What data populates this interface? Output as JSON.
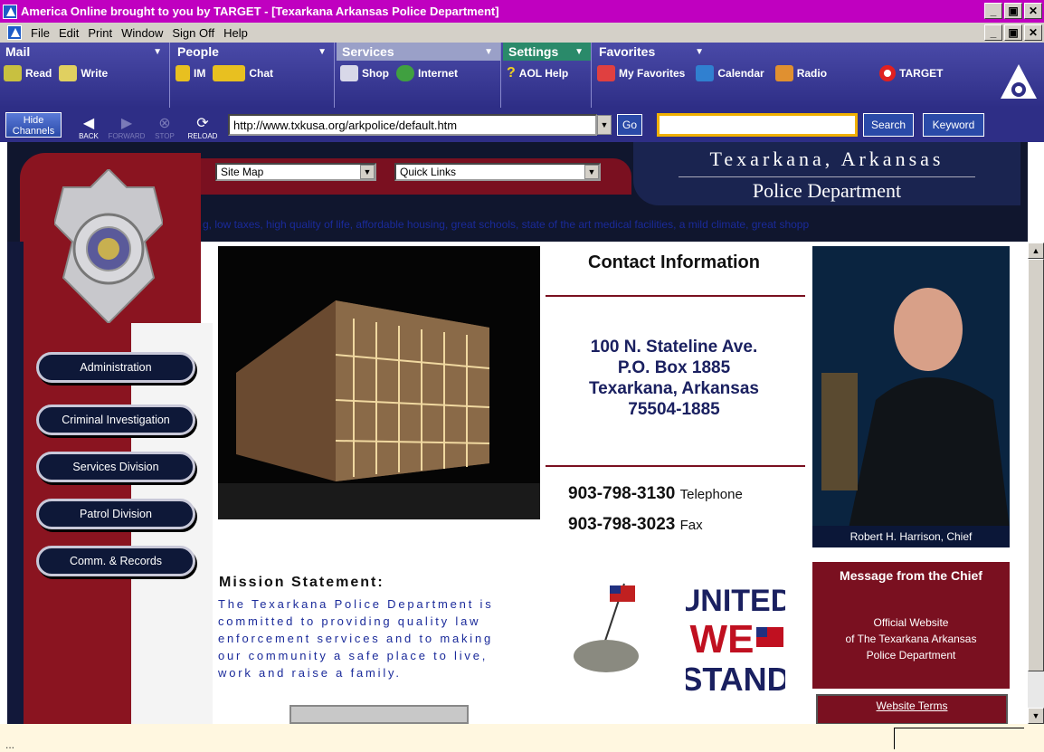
{
  "window": {
    "title": "America  Online brought to you by TARGET - [Texarkana Arkansas Police Department]"
  },
  "menu": [
    "File",
    "Edit",
    "Print",
    "Window",
    "Sign Off",
    "Help"
  ],
  "toolbar": {
    "groups": [
      {
        "label": "Mail",
        "items": [
          "Read",
          "Write"
        ]
      },
      {
        "label": "People",
        "items": [
          "IM",
          "Chat"
        ]
      },
      {
        "label": "Services",
        "items": [
          "Shop",
          "Internet"
        ]
      },
      {
        "label": "Settings",
        "items": [
          "AOL Help"
        ]
      },
      {
        "label": "Favorites",
        "items": [
          "My Favorites",
          "Calendar",
          "Radio",
          "TARGET"
        ]
      }
    ]
  },
  "addressbar": {
    "hide_channels": "Hide Channels",
    "back": "BACK",
    "forward": "FORWARD",
    "stop": "STOP",
    "reload": "RELOAD",
    "url": "http://www.txkusa.org/arkpolice/default.htm",
    "go": "Go",
    "search_value": "",
    "search": "Search",
    "keyword": "Keyword"
  },
  "site": {
    "header_line1": "Texarkana, Arkansas",
    "header_line2": "Police Department",
    "site_map": "Site Map",
    "quick_links": "Quick Links",
    "marquee": "g, low taxes, high quality of life, affordable housing, great schools, state of the art medical facilities, a mild climate, great shopp",
    "nav": [
      "Administration",
      "Criminal Investigation",
      "Services Division",
      "Patrol Division",
      "Comm. & Records"
    ],
    "contact_title": "Contact Information",
    "address": [
      "100 N. Stateline Ave.",
      "P.O. Box 1885",
      "Texarkana, Arkansas",
      "75504-1885"
    ],
    "phone": {
      "number": "903-798-3130",
      "label": "Telephone"
    },
    "fax": {
      "number": "903-798-3023",
      "label": "Fax"
    },
    "chief_caption": "Robert H. Harrison, Chief",
    "message_chief": "Message from the Chief",
    "official": [
      "Official Website",
      "of The Texarkana Arkansas",
      "Police Department"
    ],
    "terms": "Website Terms",
    "mission_title": "Mission Statement:",
    "mission_lines": [
      "The Texarkana Police Department is",
      "committed to providing quality law",
      "enforcement services and to making",
      "our community a safe place to live,",
      "work and raise a family."
    ],
    "uws": [
      "UNITED",
      "WE",
      "STAND"
    ]
  },
  "status": {
    "text": "..."
  }
}
